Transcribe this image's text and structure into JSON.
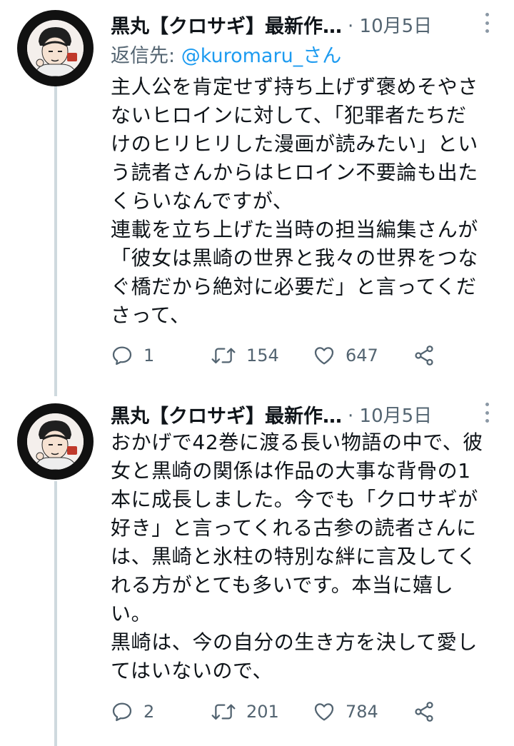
{
  "colors": {
    "text": "#0f1419",
    "secondary": "#536471",
    "link": "#1d9bf0",
    "thread_line": "#cfd9de"
  },
  "tweets": [
    {
      "author": "黒丸【クロサギ】最新作…",
      "date": "· 10月5日",
      "reply_prefix": "返信先: ",
      "reply_handle": "@kuromaru_さん",
      "lines": [
        "主人公を肯定せず持ち上げず褒めそやさ",
        "ないヒロインに対して、「犯罪者たちだ",
        "けのヒリヒリした漫画が読みたい」とい",
        "う読者さんからはヒロイン不要論も出た",
        "くらいなんですが、",
        "連載を立ち上げた当時の担当編集さんが",
        "「彼女は黒崎の世界と我々の世界をつな",
        "ぐ橋だから絶対に必要だ」と言ってくだ",
        "さって、"
      ],
      "replies": "1",
      "retweets": "154",
      "likes": "647"
    },
    {
      "author": "黒丸【クロサギ】最新作…",
      "date": "· 10月5日",
      "lines": [
        "おかげで42巻に渡る長い物語の中で、彼",
        "女と黒崎の関係は作品の大事な背骨の1",
        "本に成長しました。今でも「クロサギが",
        "好き」と言ってくれる古参の読者さんに",
        "は、黒崎と氷柱の特別な絆に言及してく",
        "れる方がとても多いです。本当に嬉し",
        "い。",
        "黒崎は、今の自分の生き方を決して愛し",
        "てはいないので、"
      ],
      "replies": "2",
      "retweets": "201",
      "likes": "784"
    }
  ],
  "icons": [
    "reply-icon",
    "retweet-icon",
    "like-icon",
    "share-icon",
    "more-icon",
    "avatar"
  ]
}
